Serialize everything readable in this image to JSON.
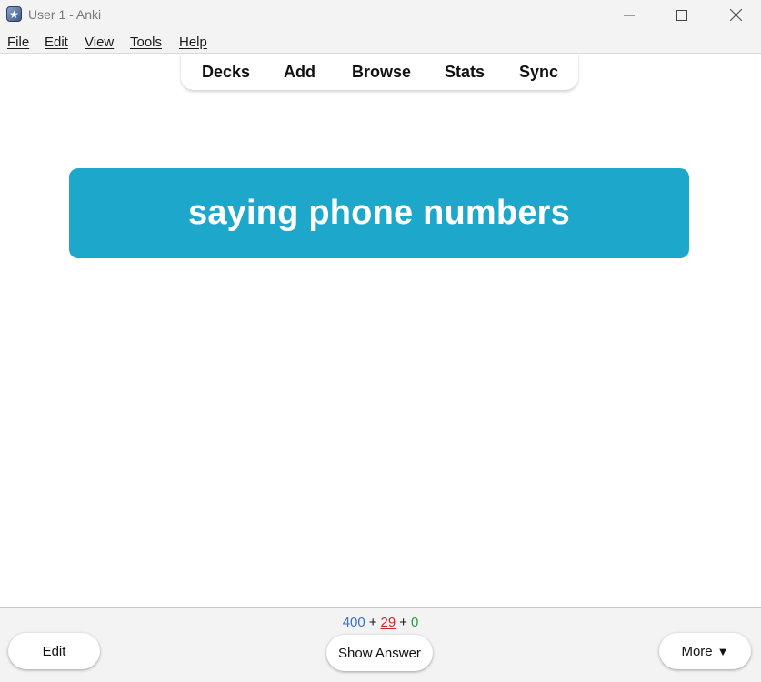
{
  "window": {
    "title": "User 1 - Anki"
  },
  "menu": {
    "items": [
      "File",
      "Edit",
      "View",
      "Tools",
      "Help"
    ]
  },
  "toolbar": {
    "items": [
      "Decks",
      "Add",
      "Browse",
      "Stats",
      "Sync"
    ]
  },
  "card": {
    "front_text": "saying phone numbers",
    "background_color": "#1da8cb"
  },
  "counts": {
    "new": "400",
    "learning": "29",
    "review": "0",
    "separator": "+",
    "new_color": "#3b6fd0",
    "learning_color": "#d0262b",
    "review_color": "#2a9a3a"
  },
  "bottom": {
    "edit_label": "Edit",
    "show_answer_label": "Show Answer",
    "more_label": "More",
    "more_arrow": "▼"
  },
  "icons": {
    "app": "anki-star-icon",
    "minimize": "minimize-icon",
    "maximize": "maximize-icon",
    "close": "close-icon"
  }
}
